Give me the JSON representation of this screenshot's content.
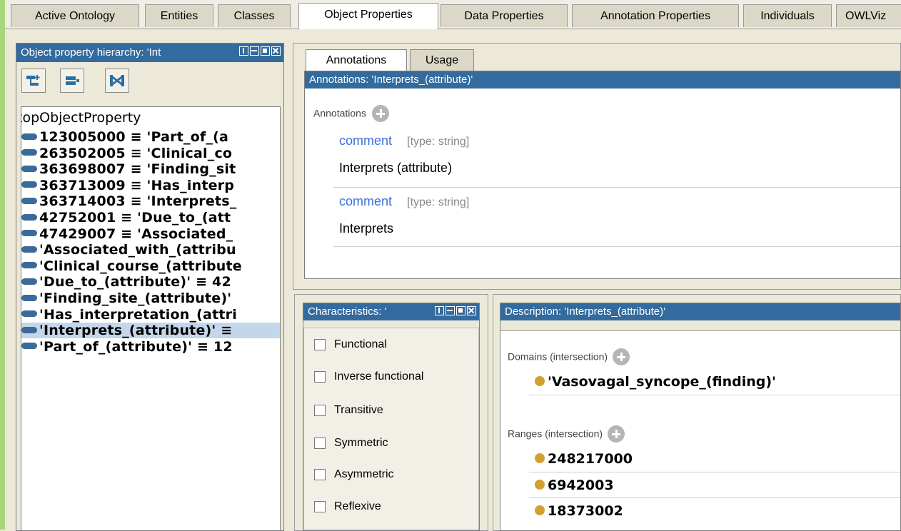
{
  "tabs": [
    "Active Ontology",
    "Entities",
    "Classes",
    "Object Properties",
    "Data Properties",
    "Annotation Properties",
    "Individuals",
    "OWLViz"
  ],
  "hierarchy": {
    "title": "Object property hierarchy: 'Int",
    "root": "topObjectProperty",
    "items": [
      "123005000 ≡ 'Part_of_(a",
      "263502005 ≡ 'Clinical_co",
      "363698007 ≡ 'Finding_sit",
      "363713009 ≡ 'Has_interp",
      "363714003 ≡ 'Interprets_",
      "42752001 ≡ 'Due_to_(att",
      "47429007 ≡ 'Associated_",
      "'Associated_with_(attribu",
      "'Clinical_course_(attribute",
      "'Due_to_(attribute)' ≡ 42",
      "'Finding_site_(attribute)'",
      "'Has_interpretation_(attri",
      "'Interprets_(attribute)' ≡",
      "'Part_of_(attribute)' ≡ 12"
    ],
    "selected_index": 12
  },
  "annotations_panel": {
    "tabs": [
      "Annotations",
      "Usage"
    ],
    "title": "Annotations: 'Interprets_(attribute)'",
    "section_label": "Annotations",
    "entries": [
      {
        "property": "comment",
        "type": "[type: string]",
        "value": "Interprets (attribute)"
      },
      {
        "property": "comment",
        "type": "[type: string]",
        "value": "Interprets"
      }
    ]
  },
  "characteristics": {
    "title": "Characteristics: '",
    "items": [
      "Functional",
      "Inverse functional",
      "Transitive",
      "Symmetric",
      "Asymmetric",
      "Reflexive"
    ]
  },
  "description": {
    "title": "Description: 'Interprets_(attribute)'",
    "domains_label": "Domains (intersection)",
    "domains": [
      "'Vasovagal_syncope_(finding)'"
    ],
    "ranges_label": "Ranges (intersection)",
    "ranges": [
      "248217000",
      "6942003",
      "18373002"
    ]
  },
  "colors": {
    "accent": "#336b9e",
    "individual_dot": "#d4a030",
    "property_pill": "#3a6a9a"
  }
}
